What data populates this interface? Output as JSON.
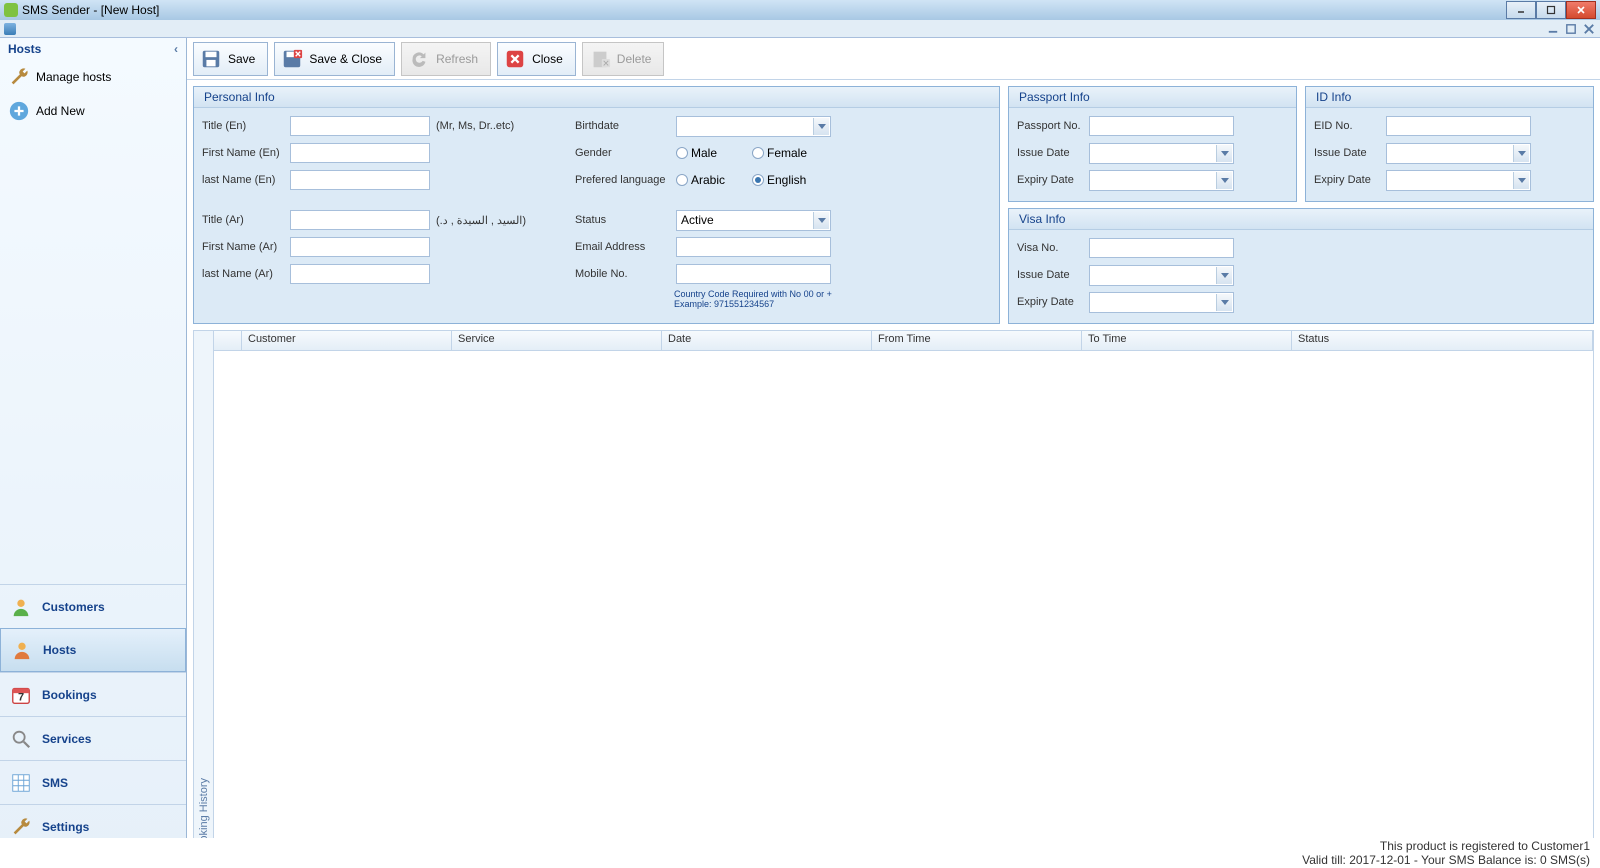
{
  "window": {
    "title": "SMS Sender - [New Host]"
  },
  "sidebar": {
    "header": "Hosts",
    "items": [
      "Manage hosts",
      "Add New"
    ],
    "nav": [
      "Customers",
      "Hosts",
      "Bookings",
      "Services",
      "SMS",
      "Settings"
    ]
  },
  "toolbar": {
    "save": "Save",
    "saveclose": "Save & Close",
    "refresh": "Refresh",
    "close": "Close",
    "delete": "Delete"
  },
  "panels": {
    "personal": {
      "title": "Personal Info",
      "title_en": "Title (En)",
      "fname_en": "First Name (En)",
      "lname_en": "last Name (En)",
      "title_ar": "Title (Ar)",
      "fname_ar": "First Name (Ar)",
      "lname_ar": "last Name (Ar)",
      "title_hint_en": "(Mr, Ms, Dr..etc)",
      "title_hint_ar": "(.السيد , السيدة , د)",
      "birthdate": "Birthdate",
      "gender": "Gender",
      "male": "Male",
      "female": "Female",
      "lang": "Prefered language",
      "arabic": "Arabic",
      "english": "English",
      "status": "Status",
      "status_val": "Active",
      "email": "Email Address",
      "mobile": "Mobile No.",
      "mobile_hint": "Country Code Required with No 00 or + Example: 971551234567"
    },
    "passport": {
      "title": "Passport Info",
      "no": "Passport No.",
      "issue": "Issue Date",
      "expiry": "Expiry Date"
    },
    "id": {
      "title": "ID Info",
      "no": "EID No.",
      "issue": "Issue Date",
      "expiry": "Expiry Date"
    },
    "visa": {
      "title": "Visa Info",
      "no": "Visa No.",
      "issue": "Issue Date",
      "expiry": "Expiry Date"
    }
  },
  "table": {
    "side_label": "Booking History",
    "cols": [
      "Customer",
      "Service",
      "Date",
      "From Time",
      "To Time",
      "Status"
    ]
  },
  "status": {
    "line1": "This product is registered to Customer1",
    "line2": "Valid till: 2017-12-01 - Your SMS Balance is: 0 SMS(s)"
  }
}
